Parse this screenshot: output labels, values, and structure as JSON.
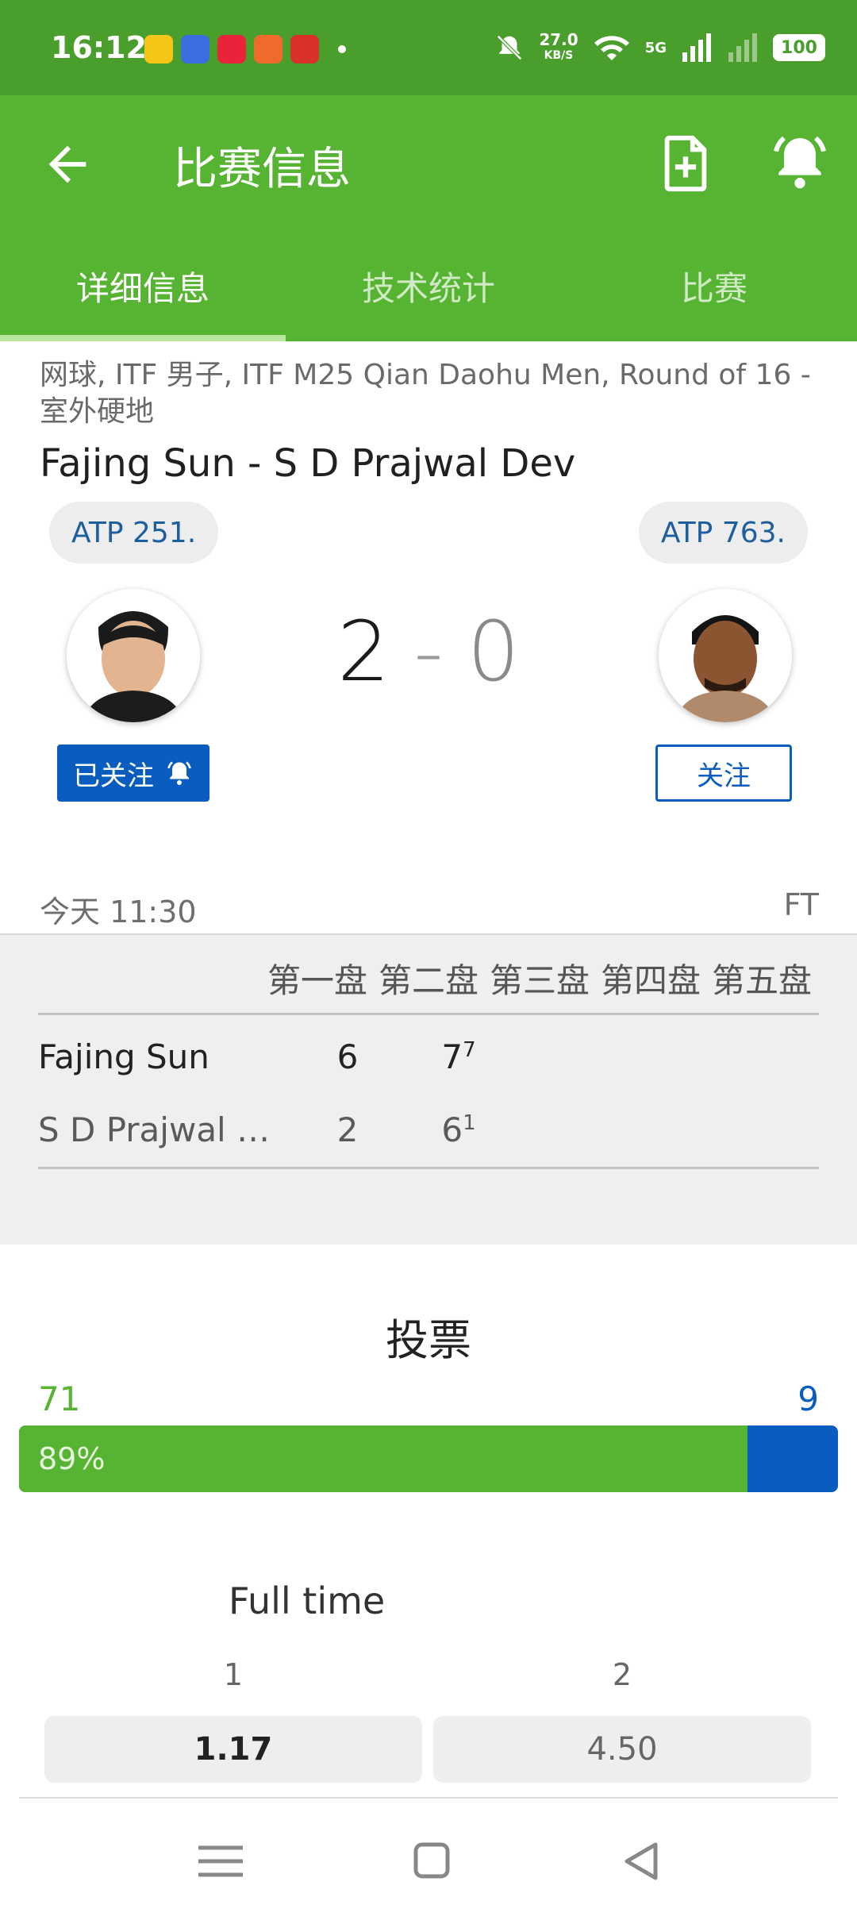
{
  "status_bar": {
    "time": "16:12",
    "net_speed": "27.0",
    "net_speed_unit": "KB/S",
    "network": "5G",
    "battery": "100"
  },
  "app_bar": {
    "title": "比赛信息",
    "back_icon": "arrow-left-icon",
    "actions": [
      "add-document-icon",
      "bell-icon"
    ]
  },
  "tabs": [
    {
      "label": "详细信息",
      "active": true
    },
    {
      "label": "技术统计",
      "active": false
    },
    {
      "label": "比赛",
      "active": false
    }
  ],
  "match": {
    "breadcrumb": "网球, ITF 男子, ITF M25 Qian Daohu Men, Round of 16 - 室外硬地",
    "title": "Fajing Sun - S D Prajwal Dev",
    "home": {
      "rank": "ATP 251.",
      "follow_label": "已关注",
      "followed": true
    },
    "away": {
      "rank": "ATP 763.",
      "follow_label": "关注",
      "followed": false
    },
    "score_home": "2",
    "score_sep": "-",
    "score_away": "0",
    "time": "今天 11:30",
    "status": "FT"
  },
  "sets": {
    "headers": [
      "第一盘",
      "第二盘",
      "第三盘",
      "第四盘",
      "第五盘"
    ],
    "rows": [
      {
        "name": "Fajing Sun",
        "s1": "6",
        "s2": "7",
        "s2_tb": "7"
      },
      {
        "name": "S D Prajwal Dev",
        "s1": "2",
        "s2": "6",
        "s2_tb": "1"
      }
    ]
  },
  "vote": {
    "title": "投票",
    "home_votes": "71",
    "away_votes": "9",
    "home_percent_label": "89%",
    "home_share": 0.89,
    "colors": {
      "home": "#57b432",
      "away": "#0a5dbf"
    }
  },
  "odds": {
    "title": "Full time",
    "col1_label": "1",
    "col2_label": "2",
    "col1_value": "1.17",
    "col2_value": "4.50"
  },
  "nav_bar": {
    "icons": [
      "menu-icon",
      "home-square-icon",
      "back-triangle-icon"
    ]
  },
  "colors": {
    "status_bar": "#4a9e2c",
    "app_bar": "#57b432",
    "accent_blue": "#0a5dbf"
  }
}
